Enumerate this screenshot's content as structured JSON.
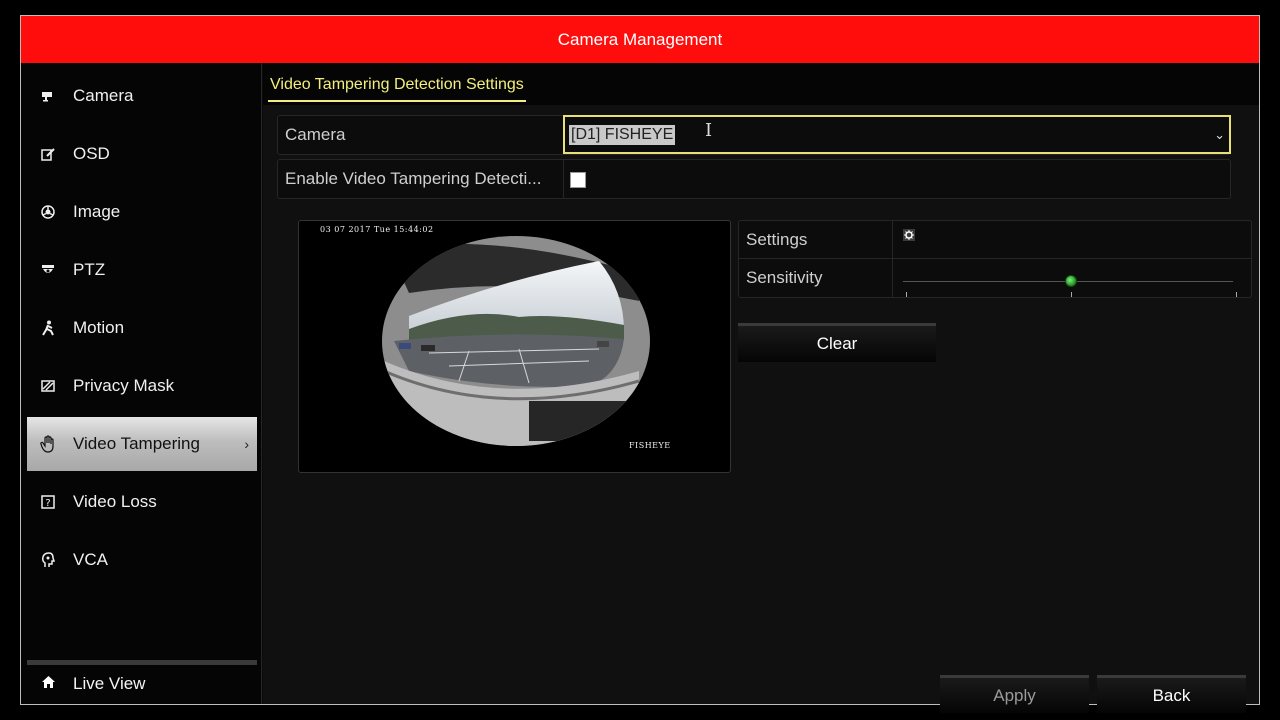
{
  "title": "Camera Management",
  "sidebar": {
    "items": [
      {
        "label": "Camera",
        "icon": "camera-icon",
        "active": false
      },
      {
        "label": "OSD",
        "icon": "osd-edit-icon",
        "active": false
      },
      {
        "label": "Image",
        "icon": "image-aperture-icon",
        "active": false
      },
      {
        "label": "PTZ",
        "icon": "ptz-dome-icon",
        "active": false
      },
      {
        "label": "Motion",
        "icon": "motion-person-icon",
        "active": false
      },
      {
        "label": "Privacy Mask",
        "icon": "privacy-mask-icon",
        "active": false
      },
      {
        "label": "Video Tampering",
        "icon": "hand-icon",
        "active": true
      },
      {
        "label": "Video Loss",
        "icon": "question-box-icon",
        "active": false
      },
      {
        "label": "VCA",
        "icon": "vca-head-icon",
        "active": false
      }
    ],
    "live_view": {
      "label": "Live View",
      "icon": "home-icon"
    }
  },
  "main": {
    "tab": "Video Tampering Detection Settings",
    "camera_label": "Camera",
    "camera_value": "[D1] FISHEYE",
    "enable_label": "Enable Video Tampering Detecti...",
    "enable_checked": false,
    "preview": {
      "osd_time": "03 07 2017 Tue 15:44:02",
      "osd_name": "FISHEYE"
    },
    "settings_label": "Settings",
    "sensitivity_label": "Sensitivity",
    "sensitivity_level": 0.5,
    "clear_label": "Clear"
  },
  "footer": {
    "apply_label": "Apply",
    "back_label": "Back"
  },
  "colors": {
    "title_bar": "#ff0d0d",
    "tab_accent": "#f4ee7e",
    "slider_knob": "#3fbf3f"
  }
}
